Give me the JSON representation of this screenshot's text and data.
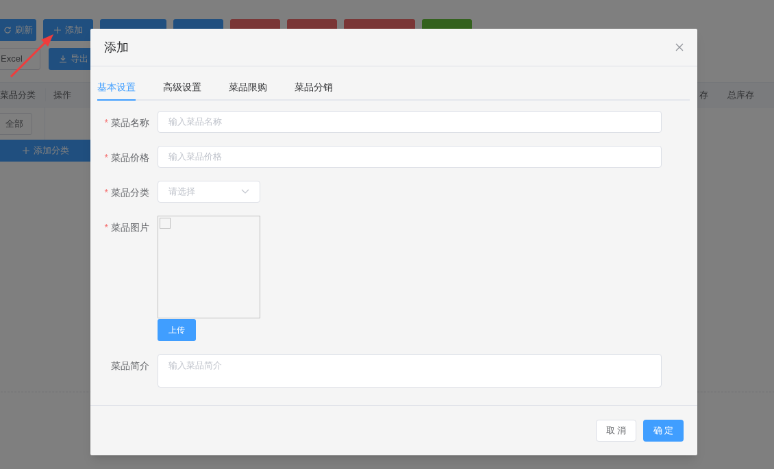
{
  "toolbar": {
    "row_1": [
      {
        "label": "刷新",
        "kind": "primary"
      },
      {
        "label": "添加",
        "kind": "primary"
      },
      {
        "kind": "primary"
      },
      {
        "kind": "primary"
      },
      {
        "kind": "danger"
      },
      {
        "kind": "danger"
      },
      {
        "kind": "danger"
      },
      {
        "kind": "success"
      }
    ],
    "export_format": {
      "value": "Excel"
    },
    "export_button": {
      "label": "导出"
    }
  },
  "table": {
    "columns": [
      "菜品分类",
      "操作",
      "存",
      "总库存"
    ]
  },
  "category_sidebar": {
    "all_button": "全部",
    "add_button": "添加分类"
  },
  "dialog": {
    "title": "添加",
    "tabs": [
      {
        "label": "基本设置",
        "selected": true
      },
      {
        "label": "高级设置",
        "selected": false
      },
      {
        "label": "菜品限购",
        "selected": false
      },
      {
        "label": "菜品分销",
        "selected": false
      }
    ],
    "fields": [
      {
        "kind": "input",
        "label": "菜品名称",
        "mark": "*",
        "placeholder": "输入菜品名称"
      },
      {
        "kind": "input",
        "label": "菜品价格",
        "mark": "*",
        "placeholder": "输入菜品价格"
      },
      {
        "kind": "select",
        "label": "菜品分类",
        "mark": "*",
        "placeholder": "请选择"
      },
      {
        "kind": "image",
        "label": "菜品图片",
        "mark": "*",
        "button": "上传"
      },
      {
        "kind": "textarea",
        "label": "菜品简介",
        "placeholder": "输入菜品简介"
      }
    ],
    "buttons": [
      {
        "label": "取 消",
        "kind": "default"
      },
      {
        "label": "确 定",
        "kind": "primary"
      }
    ]
  }
}
